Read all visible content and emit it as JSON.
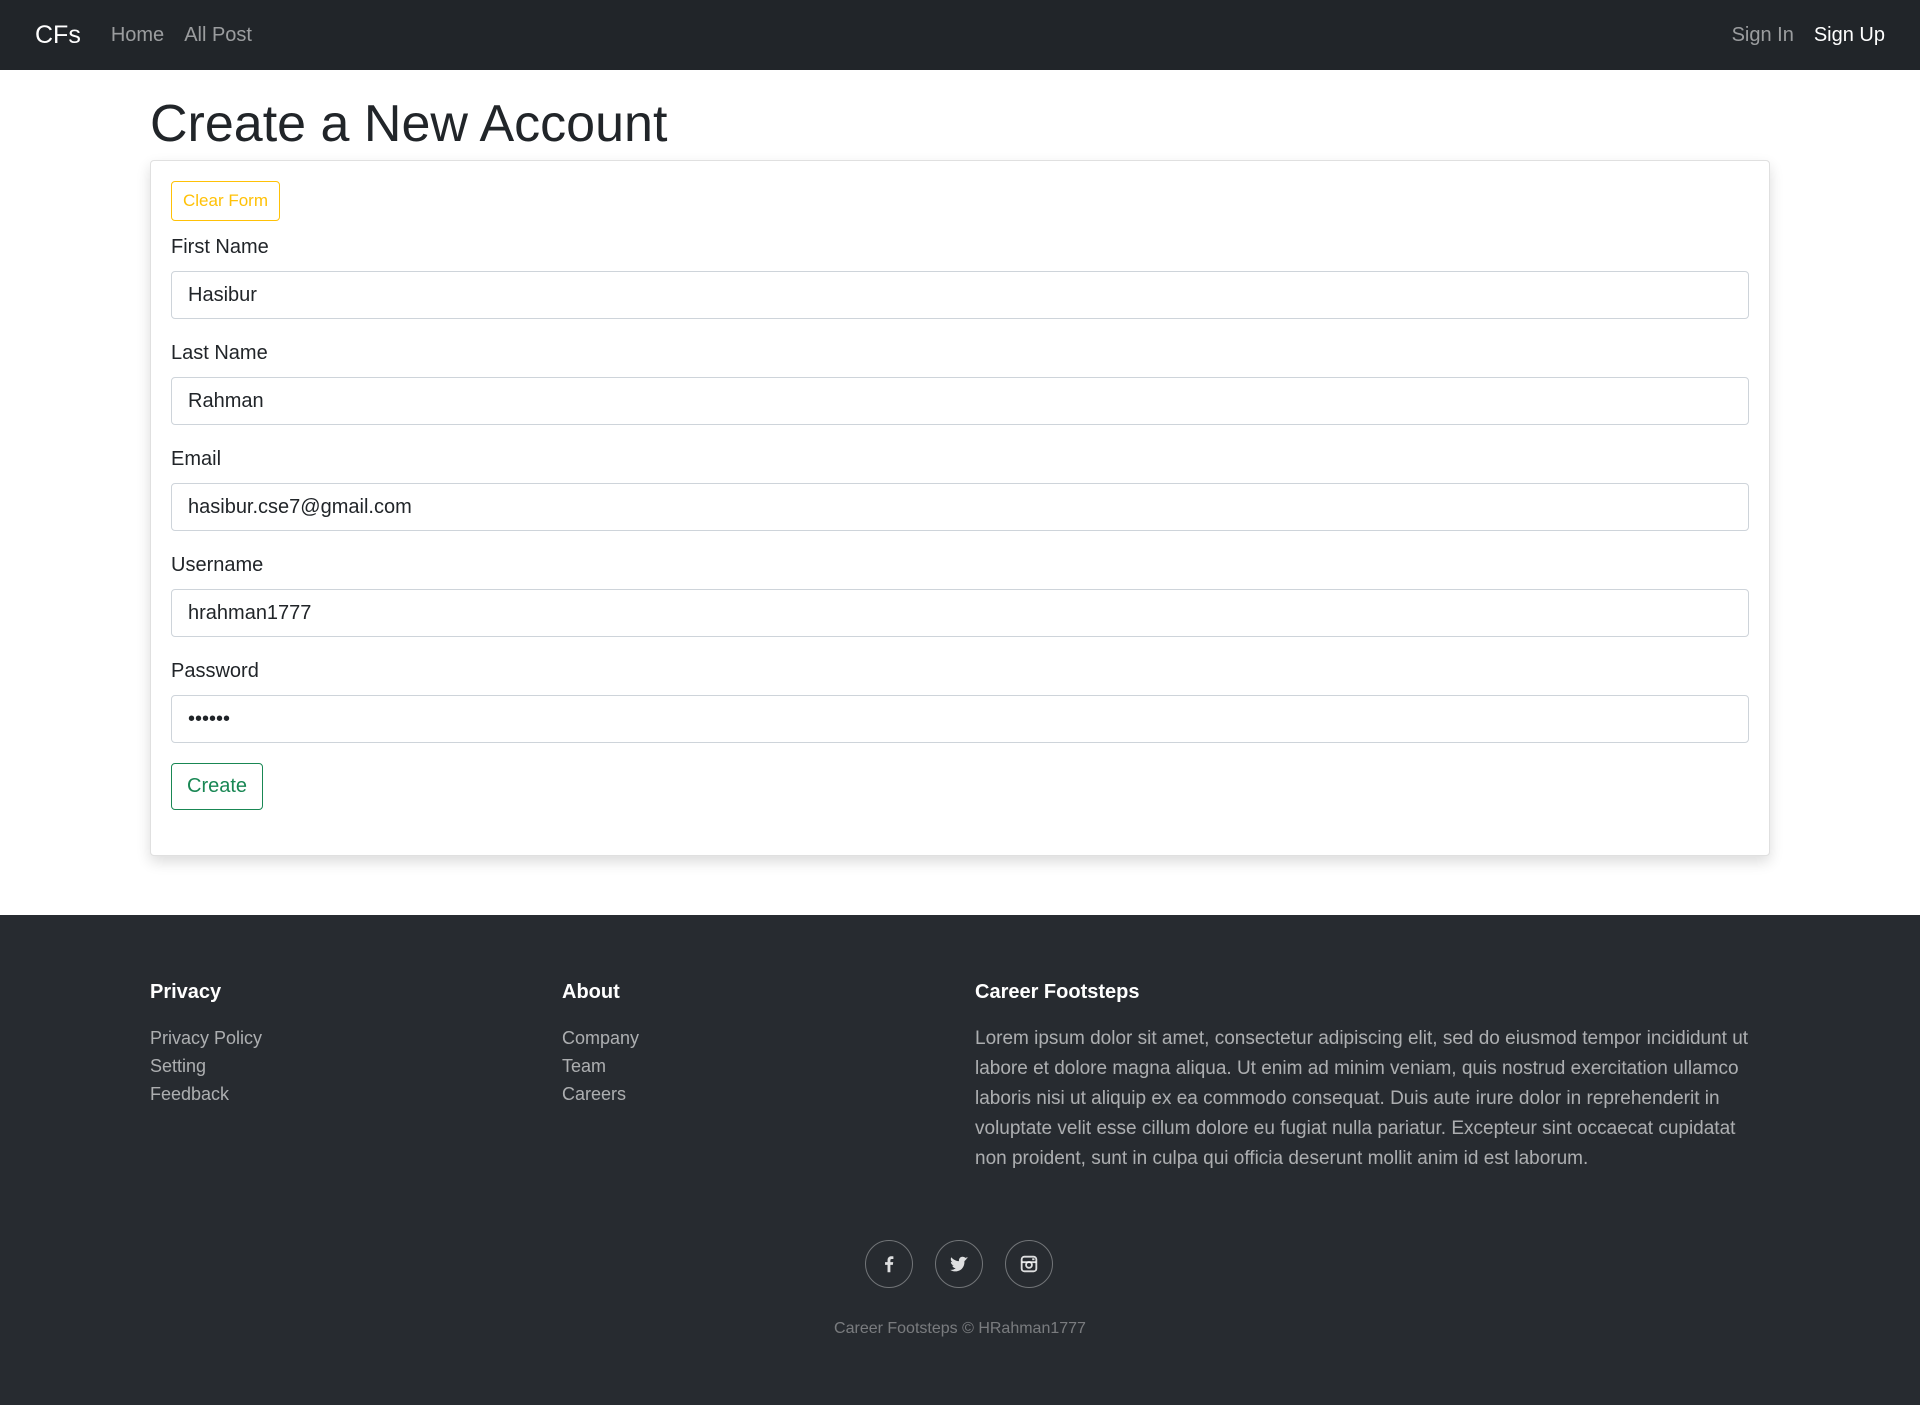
{
  "navbar": {
    "brand": "CFs",
    "links": [
      "Home",
      "All Post"
    ],
    "sign_in": "Sign In",
    "sign_up": "Sign Up"
  },
  "page": {
    "title": "Create a New Account"
  },
  "form": {
    "clear_label": "Clear Form",
    "first_name_label": "First Name",
    "first_name_value": "Hasibur",
    "last_name_label": "Last Name",
    "last_name_value": "Rahman",
    "email_label": "Email",
    "email_value": "hasibur.cse7@gmail.com",
    "username_label": "Username",
    "username_value": "hrahman1777",
    "password_label": "Password",
    "password_value": "••••••",
    "create_label": "Create"
  },
  "footer": {
    "privacy": {
      "heading": "Privacy",
      "links": [
        "Privacy Policy",
        "Setting",
        "Feedback"
      ]
    },
    "about": {
      "heading": "About",
      "links": [
        "Company",
        "Team",
        "Careers"
      ]
    },
    "career": {
      "heading": "Career Footsteps",
      "text": "Lorem ipsum dolor sit amet, consectetur adipiscing elit, sed do eiusmod tempor incididunt ut labore et dolore magna aliqua. Ut enim ad minim veniam, quis nostrud exercitation ullamco laboris nisi ut aliquip ex ea commodo consequat. Duis aute irure dolor in reprehenderit in voluptate velit esse cillum dolore eu fugiat nulla pariatur. Excepteur sint occaecat cupidatat non proident, sunt in culpa qui officia deserunt mollit anim id est laborum."
    },
    "social_icons": [
      "facebook-icon",
      "twitter-icon",
      "instagram-icon"
    ],
    "copyright": "Career Footsteps © HRahman1777"
  },
  "colors": {
    "navbar_bg": "#212529",
    "footer_bg": "#272b30",
    "warning": "#ffc107",
    "success": "#198754"
  }
}
